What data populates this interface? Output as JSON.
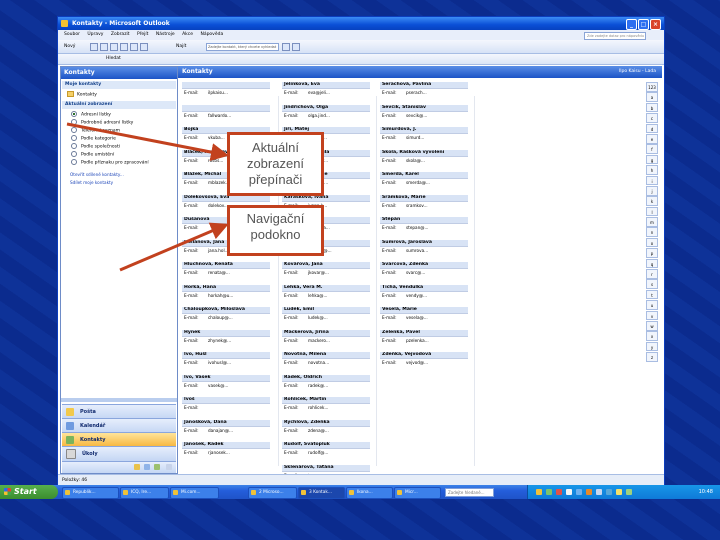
{
  "window": {
    "title": "Kontakty - Microsoft Outlook",
    "controls": {
      "minimize": "_",
      "maximize": "□",
      "close": "×"
    }
  },
  "menu": {
    "items": [
      "Soubor",
      "Úpravy",
      "Zobrazit",
      "Přejít",
      "Nástroje",
      "Akce",
      "Nápověda"
    ],
    "help_placeholder": "Zde zadejte dotaz pro nápovědu"
  },
  "toolbar": {
    "new_label": "Nový",
    "find_label": "Najít",
    "search_placeholder": "Zadejte kontakt, který chcete vyhledat",
    "find2_label": "Hledat"
  },
  "nav": {
    "header": "Kontakty",
    "my_contacts_section": "Moje kontakty",
    "contacts_item": "Kontakty",
    "current_view_section": "Aktuální zobrazení",
    "views": [
      {
        "label": "Adresní lístky",
        "selected": true
      },
      {
        "label": "Podrobné adresní lístky",
        "selected": false
      },
      {
        "label": "Telefonní seznam",
        "selected": false
      },
      {
        "label": "Podle kategorie",
        "selected": false
      },
      {
        "label": "Podle společnosti",
        "selected": false
      },
      {
        "label": "Podle umístění",
        "selected": false
      },
      {
        "label": "Podle příznaku pro zpracování",
        "selected": false
      }
    ],
    "links": [
      "Otevřít sdílené kontakty...",
      "Sdílet moje kontakty"
    ],
    "buttons": [
      {
        "label": "Pošta",
        "color": "#f2c94c"
      },
      {
        "label": "Kalendář",
        "color": "#6f9be0"
      },
      {
        "label": "Kontakty",
        "color": "#7bb45c",
        "active": true
      },
      {
        "label": "Úkoly",
        "color": "#d8d8d8"
      }
    ]
  },
  "content": {
    "header": "Kontakty",
    "range": "Ilpo Kaisu - Lada",
    "email_label": "E-mail:",
    "columns": [
      [
        {
          "name": "",
          "email": "ilpkaisu..."
        },
        {
          "name": "",
          "email": "fallwardo..."
        },
        {
          "name": "Bojka",
          "email": "vkuba..."
        },
        {
          "name": "Bláček, Rostislav",
          "email": "rostis..."
        },
        {
          "name": "Blážek, Michal",
          "email": "mblazek..."
        },
        {
          "name": "Dolekovsová, Eva",
          "email": "dolekov..."
        },
        {
          "name": "Dušanová",
          "email": ""
        },
        {
          "name": "Hollanová, Jana",
          "email": "jana.hol..."
        },
        {
          "name": "Hluchnová, Renata",
          "email": "renata@..."
        },
        {
          "name": "Horká, Hana",
          "email": "horkah@u..."
        },
        {
          "name": "Chaloupková, Miloslava",
          "email": "chaloup@..."
        },
        {
          "name": "Hynek",
          "email": "zhynek@..."
        },
        {
          "name": "Ivo, Hušl",
          "email": "ivohusl@..."
        },
        {
          "name": "Ivo, Vasek",
          "email": "vasek@..."
        },
        {
          "name": "Ivoš",
          "email": ""
        },
        {
          "name": "Janošková, Dana",
          "email": "danajan@..."
        },
        {
          "name": "Janošek, Radek",
          "email": "rjanosek..."
        }
      ],
      [
        {
          "name": "Jelínková, Eva",
          "email": "eva@jeli..."
        },
        {
          "name": "Jindřichová, Olga",
          "email": "olga.jind..."
        },
        {
          "name": "Jiří, Matěj",
          "email": "bluer@..."
        },
        {
          "name": "Kabelová, Jarmila",
          "email": "kabelov..."
        },
        {
          "name": "Kadlecová, Lucie",
          "email": "lucie.ka..."
        },
        {
          "name": "Karásková, Ivana",
          "email": "ivana.k..."
        },
        {
          "name": "Kolářová, Eva",
          "email": "kolarova..."
        },
        {
          "name": "Kolinová, Marie",
          "email": "kavaler@..."
        },
        {
          "name": "Kovářová, Jana",
          "email": "jkovar@..."
        },
        {
          "name": "Lehká, Vera M.",
          "email": "lehka@..."
        },
        {
          "name": "Luděk, Emil",
          "email": "ludek@..."
        },
        {
          "name": "Mackerová, Jiřina",
          "email": "mackero..."
        },
        {
          "name": "Novotná, Milena",
          "email": "novotna..."
        },
        {
          "name": "Radek, Oldřich",
          "email": "radek@..."
        },
        {
          "name": "Rohlíček, Martin",
          "email": "rohlicek..."
        },
        {
          "name": "Rychlová, Zdeňka",
          "email": "zdena@..."
        },
        {
          "name": "Rudolf, Svatopluk",
          "email": "rudolf@..."
        },
        {
          "name": "Sklenářová, Taťána",
          "email": "tana@..."
        }
      ],
      [
        {
          "name": "Šerachová, Pavlína",
          "email": "pserach..."
        },
        {
          "name": "Ševčík, Stanislav",
          "email": "sevcik@..."
        },
        {
          "name": "Šimurdová, J.",
          "email": "simurd..."
        },
        {
          "name": "Škola, Rašková vyvolení",
          "email": "skola@..."
        },
        {
          "name": "Šmerda, Karel",
          "email": "smerda@..."
        },
        {
          "name": "Šrámková, Marie",
          "email": "sramkov..."
        },
        {
          "name": "Štěpán",
          "email": "stepan@..."
        },
        {
          "name": "Šumrová, Jaroslava",
          "email": "sumrova..."
        },
        {
          "name": "Švarcová, Zdenka",
          "email": "svarc@..."
        },
        {
          "name": "Tichá, Vendulka",
          "email": "vendy@..."
        },
        {
          "name": "Veselá, Marie",
          "email": "vesela@..."
        },
        {
          "name": "Zelenka, Pavel",
          "email": "pzelenka..."
        },
        {
          "name": "Zdeňka, Vejvodová",
          "email": "vejvod@..."
        }
      ]
    ],
    "alphabet": [
      "123",
      "a",
      "b",
      "c",
      "d",
      "e",
      "f",
      "g",
      "h",
      "i",
      "j",
      "k",
      "l",
      "m",
      "n",
      "o",
      "p",
      "q",
      "r",
      "s",
      "t",
      "u",
      "v",
      "w",
      "x",
      "y",
      "z"
    ]
  },
  "status": {
    "items": "Položky: 46"
  },
  "taskbar": {
    "start": "Start",
    "tasks": [
      "Republik...",
      "ICQ, Ire...",
      "Mi.com...",
      "2 Microso...",
      "3 Kontak...",
      "Ikona...",
      "Micr..."
    ],
    "search_placeholder": "Zadejte hledané...",
    "clock": "10:48"
  },
  "callouts": {
    "current_view": "Aktuální zobrazení přepínači",
    "nav_pane": "Navigační podokno"
  }
}
